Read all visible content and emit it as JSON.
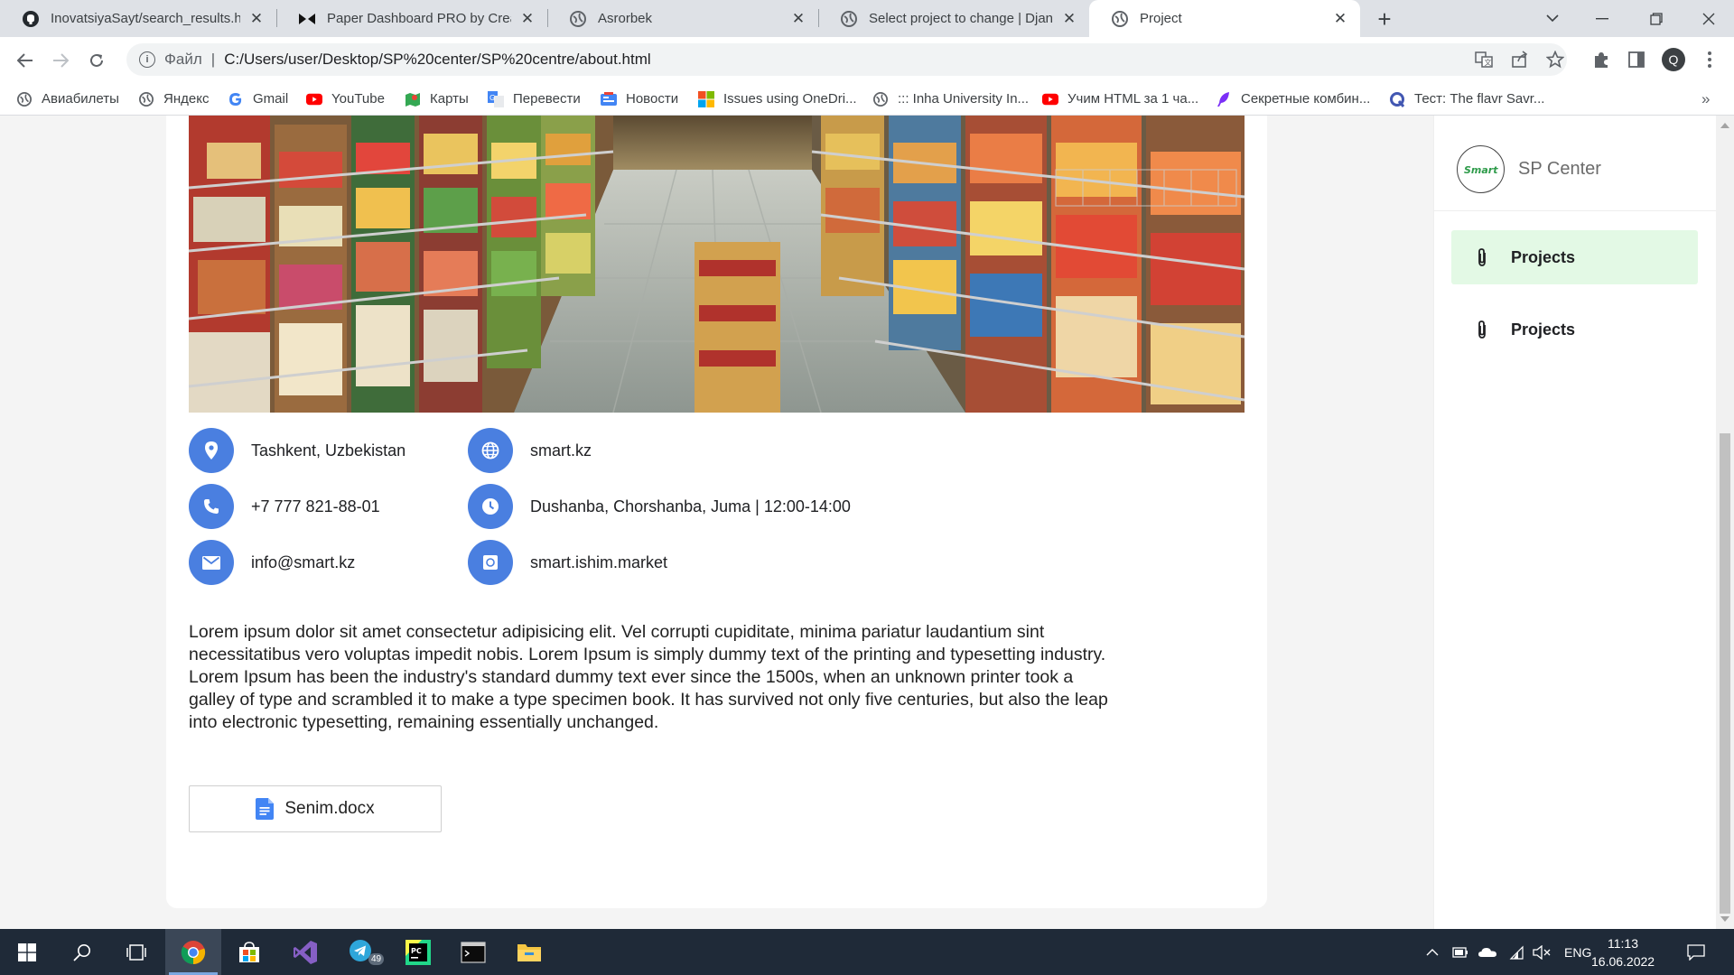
{
  "browser": {
    "tabs": [
      {
        "title": "InovatsiyaSayt/search_results.htm",
        "icon": "github-icon",
        "active": false
      },
      {
        "title": "Paper Dashboard PRO by Creativ",
        "icon": "creative-tim-icon",
        "active": false
      },
      {
        "title": "Asrorbek",
        "icon": "globe-icon",
        "active": false
      },
      {
        "title": "Select project to change | Django",
        "icon": "globe-icon",
        "active": false
      },
      {
        "title": "Project",
        "icon": "globe-icon",
        "active": true
      }
    ],
    "address": {
      "scheme_label": "Файл",
      "url": "C:/Users/user/Desktop/SP%20center/SP%20centre/about.html"
    },
    "profile_initial": "Q",
    "bookmarks": [
      {
        "label": "Авиабилеты",
        "icon": "globe-icon"
      },
      {
        "label": "Яндекс",
        "icon": "globe-icon"
      },
      {
        "label": "Gmail",
        "icon": "google-icon"
      },
      {
        "label": "YouTube",
        "icon": "youtube-icon"
      },
      {
        "label": "Карты",
        "icon": "maps-icon"
      },
      {
        "label": "Перевести",
        "icon": "translate-icon"
      },
      {
        "label": "Новости",
        "icon": "news-icon"
      },
      {
        "label": "Issues using OneDri...",
        "icon": "microsoft-icon"
      },
      {
        "label": "::: Inha University In...",
        "icon": "globe-icon"
      },
      {
        "label": "Учим HTML за 1 ча...",
        "icon": "youtube-icon"
      },
      {
        "label": "Секретные комбин...",
        "icon": "feather-icon"
      },
      {
        "label": "Тест: The flavr Savr...",
        "icon": "quizlet-icon"
      }
    ],
    "more_bookmarks": "»"
  },
  "page": {
    "hero_alt": "supermarket-aisle-image",
    "info": {
      "location": "Tashkent, Uzbekistan",
      "website": "smart.kz",
      "phone": "+7 777 821-88-01",
      "hours": "Dushanba, Chorshanba, Juma | 12:00-14:00",
      "email": "info@smart.kz",
      "instagram": "smart.ishim.market"
    },
    "description": "Lorem ipsum dolor sit amet consectetur adipisicing elit. Vel corrupti cupiditate, minima pariatur laudantium sint necessitatibus vero voluptas impedit nobis. Lorem Ipsum is simply dummy text of the printing and typesetting industry. Lorem Ipsum has been the industry's standard dummy text ever since the 1500s, when an unknown printer took a galley of type and scrambled it to make a type specimen book. It has survived not only five centuries, but also the leap into electronic typesetting, remaining essentially unchanged.",
    "file": {
      "name": "Senim.docx",
      "icon": "google-docs-icon"
    }
  },
  "sidebar": {
    "logo_text": "Smart",
    "brand": "SP Center",
    "items": [
      {
        "label": "Projects",
        "icon": "paperclip-icon",
        "active": true
      },
      {
        "label": "Projects",
        "icon": "paperclip-icon",
        "active": false
      }
    ]
  },
  "taskbar": {
    "apps": [
      "start-icon",
      "search-icon",
      "task-view-icon",
      "chrome-icon",
      "store-icon",
      "visual-studio-icon",
      "telegram-icon",
      "pycharm-icon",
      "terminal-icon",
      "file-explorer-icon"
    ],
    "telegram_badge": "49",
    "language": "ENG",
    "time": "11:13",
    "date": "16.06.2022"
  },
  "colors": {
    "accent_blue": "#4a7fe0",
    "sidebar_active": "#e3f9e5",
    "taskbar": "#1f2a38"
  }
}
